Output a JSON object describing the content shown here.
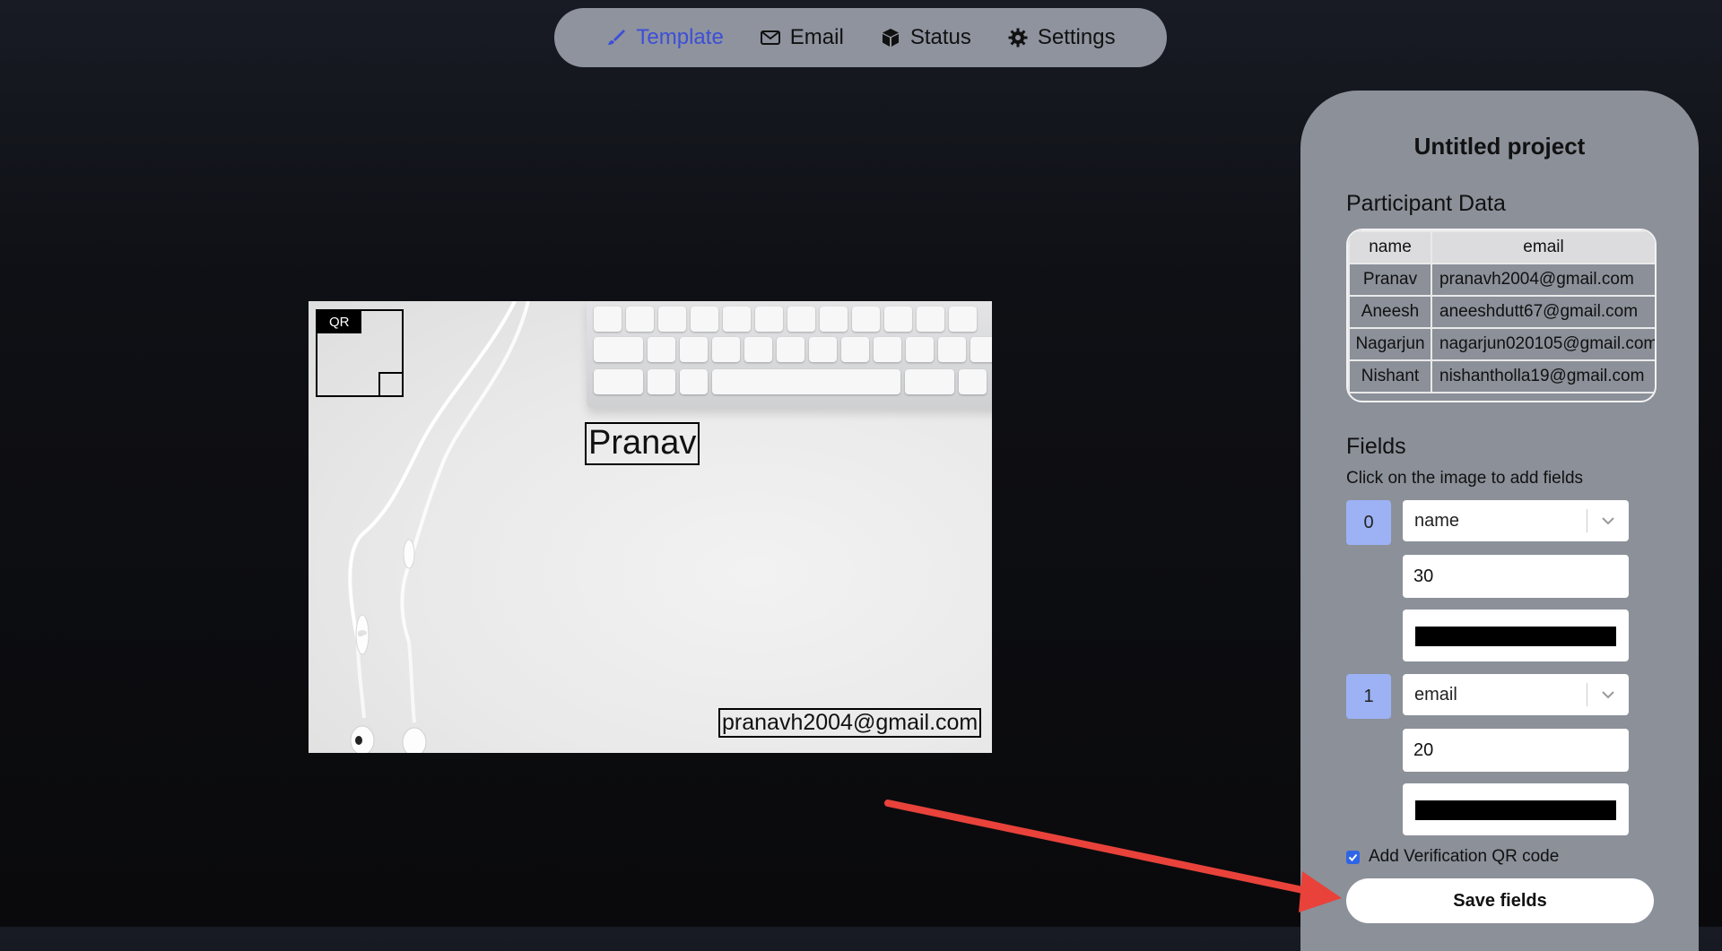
{
  "nav": {
    "items": [
      {
        "label": "Template",
        "icon": "brush-icon",
        "active": true
      },
      {
        "label": "Email",
        "icon": "envelope-icon",
        "active": false
      },
      {
        "label": "Status",
        "icon": "box-icon",
        "active": false
      },
      {
        "label": "Settings",
        "icon": "gear-icon",
        "active": false
      }
    ]
  },
  "canvas": {
    "qr_label": "QR",
    "field_name_text": "Pranav",
    "field_email_text": "pranavh2004@gmail.com"
  },
  "panel": {
    "title": "Untitled project",
    "participant_title": "Participant Data",
    "table": {
      "columns": [
        "name",
        "email"
      ],
      "rows": [
        [
          "Pranav",
          "pranavh2004@gmail.com"
        ],
        [
          "Aneesh",
          "aneeshdutt67@gmail.com"
        ],
        [
          "Nagarjun",
          "nagarjun020105@gmail.com"
        ],
        [
          "Nishant",
          "nishantholla19@gmail.com"
        ]
      ]
    },
    "fields_title": "Fields",
    "fields_hint": "Click on the image to add fields",
    "fields": [
      {
        "index": "0",
        "column": "name",
        "size": "30",
        "color": "#000000"
      },
      {
        "index": "1",
        "column": "email",
        "size": "20",
        "color": "#000000"
      }
    ],
    "qr_checkbox_label": "Add Verification QR code",
    "qr_checked": true,
    "save_label": "Save fields"
  },
  "colors": {
    "accent": "#3d4fd6",
    "index_badge": "#9db2f5",
    "arrow": "#e8423a"
  }
}
